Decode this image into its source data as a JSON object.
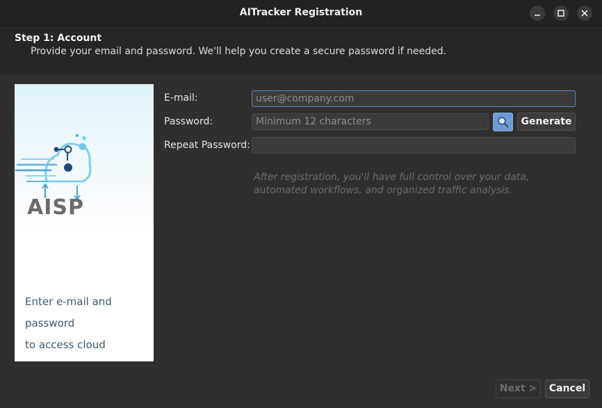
{
  "window": {
    "title": "AITracker Registration"
  },
  "header": {
    "step": "Step 1: Account",
    "description": "Provide your email and password. We'll help you create a secure password if needed."
  },
  "side": {
    "logo_text": "AISP",
    "caption_line1": "Enter e-mail and password",
    "caption_line2": "to access cloud processing."
  },
  "form": {
    "email_label": "E-mail:",
    "email_placeholder": "user@company.com",
    "email_value": "",
    "password_label": "Password:",
    "password_placeholder": "Minimum 12 characters",
    "password_value": "",
    "repeat_label": "Repeat Password:",
    "repeat_value": "",
    "generate_label": "Generate",
    "info": "After registration, you'll have full control over your data, automated workflows, and organized traffic analysis."
  },
  "footer": {
    "next_label": "Next >",
    "cancel_label": "Cancel"
  },
  "colors": {
    "accent": "#6e9bd6",
    "window_bg": "#2f2f2f",
    "titlebar_bg": "#222222"
  },
  "icons": {
    "minimize": "minimize-icon",
    "maximize": "maximize-icon",
    "close": "close-icon",
    "search": "search-icon",
    "logo": "cloud-network-icon"
  }
}
